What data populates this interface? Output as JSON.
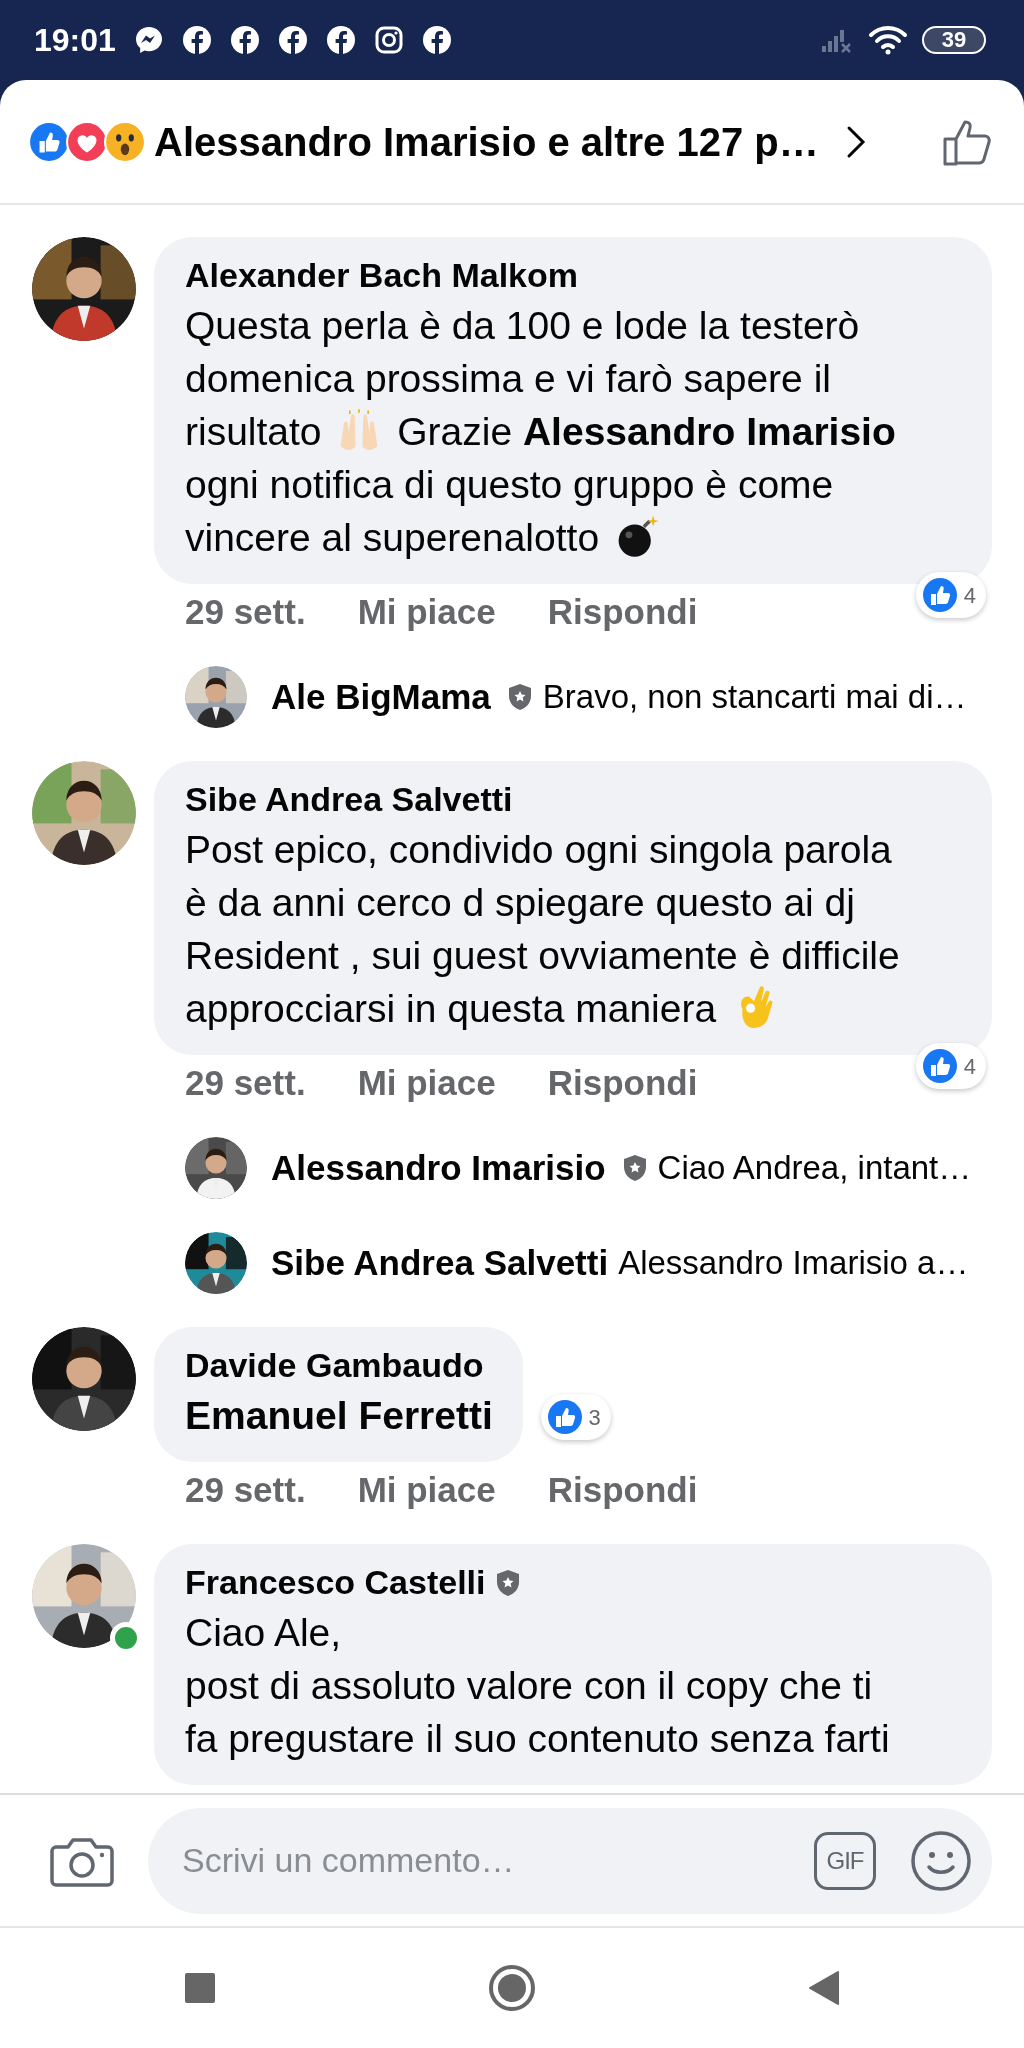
{
  "status_bar": {
    "time": "19:01",
    "notifications": [
      {
        "kind": "messenger"
      },
      {
        "kind": "facebook"
      },
      {
        "kind": "facebook"
      },
      {
        "kind": "facebook"
      },
      {
        "kind": "facebook"
      },
      {
        "kind": "instagram"
      },
      {
        "kind": "facebook"
      }
    ],
    "battery": "39"
  },
  "header": {
    "reactions": [
      {
        "kind": "like"
      },
      {
        "kind": "love"
      },
      {
        "kind": "wow"
      }
    ],
    "title": "Alessandro Imarisio e altre 127 p…"
  },
  "comments": [
    {
      "author": "Alexander Bach Malkom",
      "admin": false,
      "online": false,
      "kind": "long",
      "lines": [
        [
          {
            "kind": "text",
            "text": "Questa perla è da 100 e lode la testerò"
          }
        ],
        [
          {
            "kind": "text",
            "text": "domenica prossima e vi farò sapere il"
          }
        ],
        [
          {
            "kind": "text",
            "text": "risultato"
          },
          {
            "kind": "clap"
          },
          {
            "kind": "text",
            "text": "Grazie **Alessandro Imarisio**"
          }
        ],
        [
          {
            "kind": "text",
            "text": "ogni notifica di questo gruppo è come"
          }
        ],
        [
          {
            "kind": "text",
            "text": "vincere al superenalotto"
          },
          {
            "kind": "bomb"
          }
        ]
      ],
      "time": "29 sett.",
      "like": "Mi piace",
      "reply": "Rispondi",
      "reaction_count": "4",
      "replies": [
        {
          "author": "Ale BigMama",
          "admin": true,
          "text": "Bravo, non stancarti mai di…"
        }
      ]
    },
    {
      "author": "Sibe Andrea Salvetti",
      "admin": false,
      "online": false,
      "kind": "long",
      "lines": [
        [
          {
            "kind": "text",
            "text": "Post epico, condivido ogni singola parola"
          }
        ],
        [
          {
            "kind": "text",
            "text": "è da anni cerco d spiegare questo ai dj"
          }
        ],
        [
          {
            "kind": "text",
            "text": "Resident , sui guest ovviamente è difficile"
          }
        ],
        [
          {
            "kind": "text",
            "text": "approcciarsi in questa maniera"
          },
          {
            "kind": "ok-hand"
          }
        ]
      ],
      "time": "29 sett.",
      "like": "Mi piace",
      "reply": "Rispondi",
      "reaction_count": "4",
      "replies": [
        {
          "author": "Alessandro Imarisio",
          "admin": true,
          "text": "Ciao Andrea, intant…"
        },
        {
          "author": "Sibe Andrea Salvetti",
          "admin": false,
          "text": "Alessandro Imarisio a…"
        }
      ]
    },
    {
      "author": "Davide Gambaudo",
      "admin": false,
      "online": false,
      "kind": "short",
      "lines": [
        [
          {
            "kind": "mention",
            "text": "Emanuel Ferretti"
          }
        ]
      ],
      "time": "29 sett.",
      "like": "Mi piace",
      "reply": "Rispondi",
      "reaction_count": "3"
    },
    {
      "author": "Francesco Castelli",
      "admin": true,
      "online": true,
      "kind": "long",
      "lines": [
        [
          {
            "kind": "text",
            "text": "Ciao Ale,"
          }
        ],
        [
          {
            "kind": "text",
            "text": "post di assoluto valore con il copy che ti"
          }
        ],
        [
          {
            "kind": "text",
            "text": "fa pregustare il suo contenuto senza farti"
          }
        ]
      ]
    }
  ],
  "composer": {
    "placeholder": "Scrivi un commento…",
    "gif": "GIF"
  }
}
